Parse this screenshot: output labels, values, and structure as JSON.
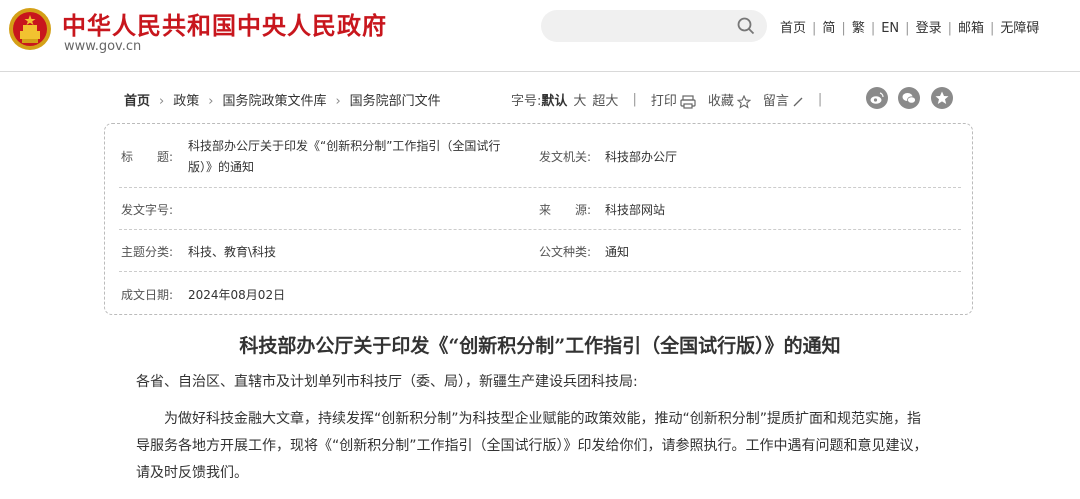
{
  "header": {
    "site_title": "中华人民共和国中央人民政府",
    "site_url": "www.gov.cn",
    "search_placeholder": "",
    "nav": [
      "首页",
      "简",
      "繁",
      "EN",
      "登录",
      "邮箱",
      "无障碍"
    ],
    "brand_color": "#c8161d"
  },
  "breadcrumb": {
    "items": [
      "首页",
      "政策",
      "国务院政策文件库",
      "国务院部门文件"
    ]
  },
  "tools": {
    "font_size_label": "字号:",
    "font_default": "默认",
    "font_large": "大",
    "font_xlarge": "超大",
    "print": "打印",
    "favorite": "收藏",
    "comment": "留言",
    "share_icons": [
      "weibo-icon",
      "wechat-icon",
      "qzone-icon"
    ]
  },
  "info": {
    "title_label": "标　　题:",
    "title_line1": "科技部办公厅关于印发《“创新积分制”工作指引（全国试行",
    "title_line2": "版）》的通知",
    "issuer_label": "发文机关:",
    "issuer_value": "科技部办公厅",
    "docno_label": "发文字号:",
    "docno_value": "",
    "source_label": "来　　源:",
    "source_value": "科技部网站",
    "category_label": "主题分类:",
    "category_value": "科技、教育\\科技",
    "doctype_label": "公文种类:",
    "doctype_value": "通知",
    "date_label": "成文日期:",
    "date_value": "2024年08月02日"
  },
  "article": {
    "title": "科技部办公厅关于印发《“创新积分制”工作指引（全国试行版）》的通知",
    "salutation": "各省、自治区、直辖市及计划单列市科技厅（委、局），新疆生产建设兵团科技局:",
    "body_line1": "为做好科技金融大文章，持续发挥“创新积分制”为科技型企业赋能的政策效能，推动“创新积分制”提质扩面和规范实施，指",
    "body_line2": "导服务各地方开展工作，现将《“创新积分制”工作指引（全国试行版）》印发给你们，请参照执行。工作中遇有问题和意见建议，",
    "body_line3": "请及时反馈我们。"
  }
}
